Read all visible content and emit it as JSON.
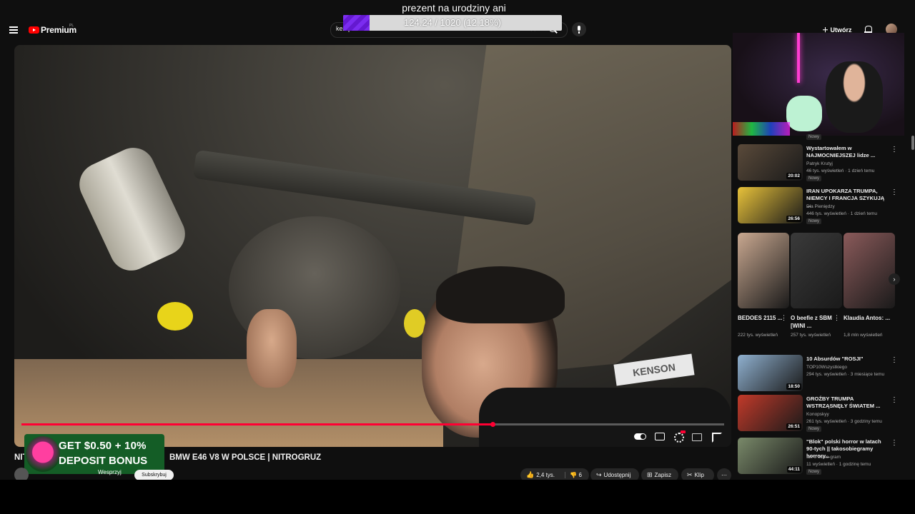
{
  "header": {
    "logo_text": "Premium",
    "logo_region": "PL",
    "search_value": "kempson",
    "create_label": "Utwórz"
  },
  "overlay": {
    "donation_title": "prezent na urodziny ani",
    "goal_text": "124.24 / 1020 (12.18%)",
    "goal_fraction": 0.1218
  },
  "player": {
    "progress_fraction": 0.67,
    "scene_text": "KENSON",
    "ad": {
      "line1": "GET $0.50 + 10%",
      "line2": "DEPOSIT BONUS"
    }
  },
  "video": {
    "title": "NITROGRUZ — BMW E46 V8 W POLSCE | NITROGRUZ",
    "title_prefix": "NIT",
    "title_visible": "BMW E46 V8 W POLSCE | NITROGRUZ",
    "support_label": "Wesprzyj",
    "subscribe_label": "Subskrybuj",
    "channel_line": "",
    "likes": "2,4 tys.",
    "dislikes": "6",
    "share_label": "Udostępnij",
    "save_label": "Zapisz",
    "clip_label": "Klip"
  },
  "sidebar": {
    "webcam_new": "Nowy",
    "videos": [
      {
        "title": "Wystartowałem w NAJMOCNIEJSZEJ lidze ...",
        "channel": "Patryk Krutyj",
        "meta": "46 tys. wyświetleń · 1 dzień temu",
        "badge": "Nowy",
        "duration": "20:02",
        "thumb_color": "#5a4a3a"
      },
      {
        "title": "IRAN UPOKARZA TRUMPA, NIEMCY I FRANCJA SZYKUJĄ ...",
        "channel": "Dla Pieniędzy",
        "meta": "446 tys. wyświetleń · 1 dzień temu",
        "badge": "Nowy",
        "duration": "26:56",
        "thumb_color": "#e8c23a"
      },
      {
        "title": "10 Absurdów \"ROSJI\"",
        "channel": "TOP10Wszystkiego",
        "meta": "294 tys. wyświetleń · 3 miesiące temu",
        "badge": "",
        "duration": "18:50",
        "thumb_color": "#8fb0cf"
      },
      {
        "title": "GROŹBY TRUMPA WSTRZĄSNĘŁY ŚWIATEM ...",
        "channel": "Konopskyy",
        "meta": "261 tys. wyświetleń · 3 godziny temu",
        "badge": "Nowy",
        "duration": "26:51",
        "thumb_color": "#c23a2a"
      },
      {
        "title": "\"Blok\" polski horror w latach 90-tych || takosobiegramy horrory...",
        "channel": "tak o sobie gram",
        "meta": "11 wyświetleń · 1 godzinę temu",
        "badge": "Nowy",
        "duration": "44:11",
        "thumb_color": "#7a8a6a"
      }
    ],
    "shorts": [
      {
        "title": "BEDOES 2115 ...",
        "meta": "222 tys. wyświetleń",
        "thumb_color": "#c9a890"
      },
      {
        "title": "O beefie z SBM [WINI ...",
        "meta": "257 tys. wyświetleń",
        "thumb_color": "#3a3a3a"
      },
      {
        "title": "Klaudia Antos: ...",
        "meta": "1,8 mln wyświetleń",
        "thumb_color": "#8a5a5a"
      }
    ]
  }
}
